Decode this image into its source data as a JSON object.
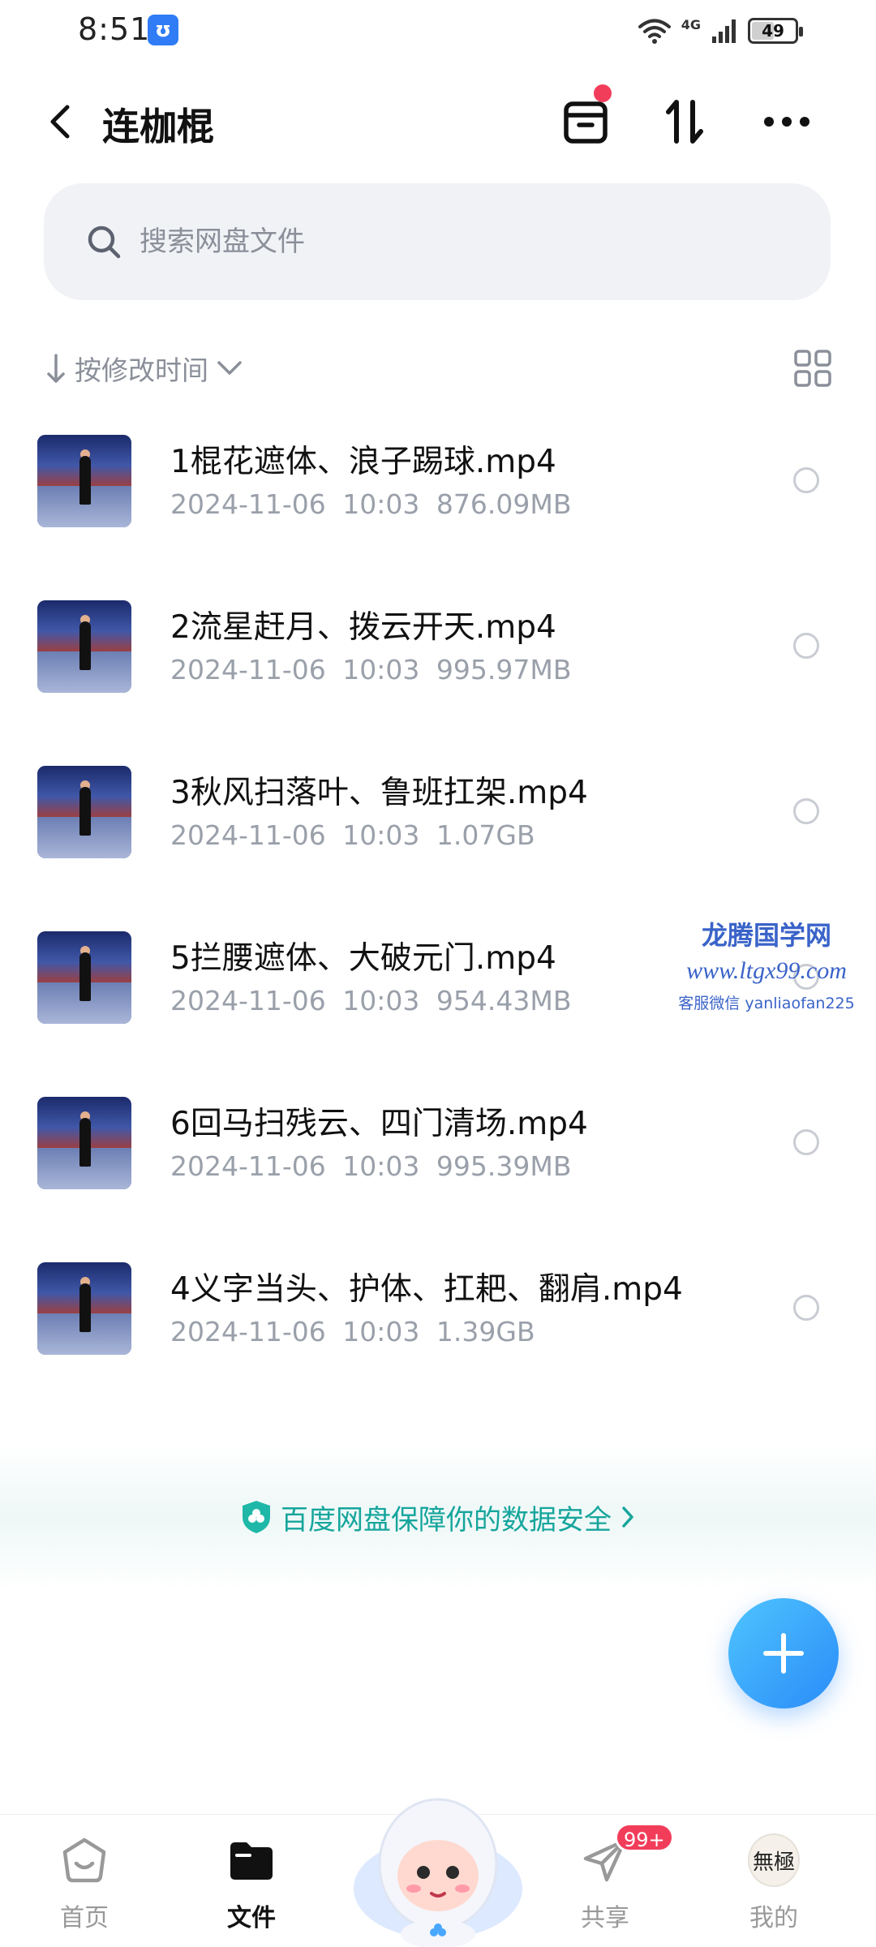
{
  "status_bar": {
    "time": "8:51",
    "app_badge": "ʊ",
    "network": "4G",
    "battery": "49",
    "battery_level": 0.49
  },
  "header": {
    "title": "连枷棍"
  },
  "search": {
    "placeholder": "搜索网盘文件"
  },
  "sort": {
    "label": "按修改时间"
  },
  "files": [
    {
      "name": "1棍花遮体、浪子踢球.mp4",
      "date": "2024-11-06",
      "time": "10:03",
      "size": "876.09MB"
    },
    {
      "name": "2流星赶月、拨云开天.mp4",
      "date": "2024-11-06",
      "time": "10:03",
      "size": "995.97MB"
    },
    {
      "name": "3秋风扫落叶、鲁班扛架.mp4",
      "date": "2024-11-06",
      "time": "10:03",
      "size": "1.07GB"
    },
    {
      "name": "5拦腰遮体、大破元门.mp4",
      "date": "2024-11-06",
      "time": "10:03",
      "size": "954.43MB"
    },
    {
      "name": "6回马扫残云、四门清场.mp4",
      "date": "2024-11-06",
      "time": "10:03",
      "size": "995.39MB"
    },
    {
      "name": "4义字当头、护体、扛耙、翻肩.mp4",
      "date": "2024-11-06",
      "time": "10:03",
      "size": "1.39GB"
    }
  ],
  "watermark": {
    "line1": "龙腾国学网",
    "line2": "www.ltgx99.com",
    "line3": "客服微信 yanliaofan225"
  },
  "security": {
    "text": "百度网盘保障你的数据安全"
  },
  "nav": {
    "home": "首页",
    "files": "文件",
    "share": "共享",
    "share_badge": "99+",
    "mine": "我的",
    "avatar_text": "無極"
  },
  "colors": {
    "accent": "#2a8cf8",
    "security": "#16a59c",
    "badge": "#f23d5a"
  }
}
